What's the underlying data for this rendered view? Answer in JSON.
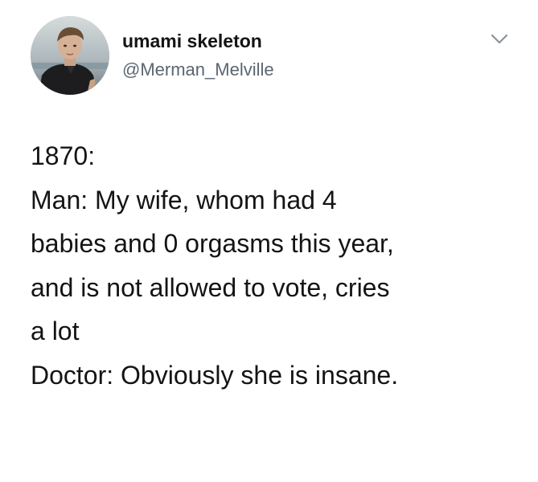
{
  "user": {
    "display_name": "umami skeleton",
    "handle": "@Merman_Melville"
  },
  "icons": {
    "avatar": "profile-photo",
    "menu": "chevron-down-icon"
  },
  "tweet": {
    "lines": [
      "1870:",
      "Man: My wife, whom had 4",
      "babies and 0 orgasms this year,",
      "and is not allowed to vote, cries",
      "a lot",
      "Doctor: Obviously she is insane."
    ]
  },
  "colors": {
    "text": "#141414",
    "secondary_text": "#5b6670",
    "background": "#ffffff"
  }
}
